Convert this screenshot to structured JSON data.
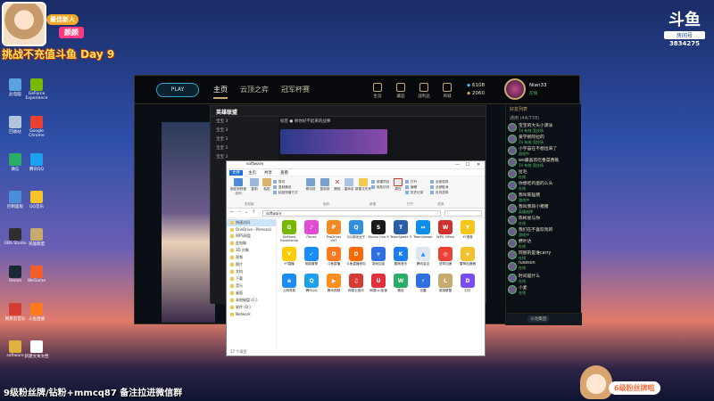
{
  "overlay": {
    "badge": "最佳新人",
    "name": "颜颜",
    "challenge": "挑战不充值斗鱼 Day 9",
    "bottom_text": "9级粉丝牌/钻粉+mmcq87 备注拉进微信群",
    "douyu_brand": "斗鱼",
    "room_label": "房间号",
    "room_number": "3834275",
    "fan_badge": "6级粉丝牌啦"
  },
  "desktop_icons": [
    {
      "label": "此电脑",
      "color": "#5ba3e0"
    },
    {
      "label": "GeForce Experience",
      "color": "#76b900"
    },
    {
      "label": "回收站",
      "color": "#b0c4de"
    },
    {
      "label": "Google Chrome",
      "color": "#e94235"
    },
    {
      "label": "微信",
      "color": "#2aae67"
    },
    {
      "label": "腾讯QQ",
      "color": "#1ea0f0"
    },
    {
      "label": "控制面板",
      "color": "#4a90d9"
    },
    {
      "label": "QQ音乐",
      "color": "#f7c52b"
    },
    {
      "label": "OBS Studio",
      "color": "#302e31"
    },
    {
      "label": "英雄联盟",
      "color": "#c8aa6e"
    },
    {
      "label": "Steam",
      "color": "#1b2838"
    },
    {
      "label": "WeGame",
      "color": "#f25f2c"
    },
    {
      "label": "网易云音乐",
      "color": "#d43c33"
    },
    {
      "label": "斗鱼直播",
      "color": "#ff7a1f"
    },
    {
      "label": "software",
      "color": "#e0b040"
    },
    {
      "label": "新建文本文档",
      "color": "#ffffff"
    }
  ],
  "lol": {
    "play": "PLAY",
    "tabs": [
      "主页",
      "云顶之弈",
      "冠军杯赛"
    ],
    "icons": [
      "生涯",
      "藏品",
      "战利品",
      "商城"
    ],
    "currency_be": "6108",
    "currency_rp": "2060",
    "username": "Nian33",
    "status": "在线",
    "friends_header": "好友列表",
    "friends_group": "通用 (44/778)",
    "friends": [
      {
        "name": "宝宝的大头小源泳",
        "status": "1V 有效·竞技场"
      },
      {
        "name": "爱学新阿拉的",
        "status": "1V 有效·竞技场"
      },
      {
        "name": "小宇宙在不想出来了",
        "status": "游戏中"
      },
      {
        "name": "wo最喜欢吃香菜香蕉",
        "status": "1V 有效·竞技场"
      },
      {
        "name": "拉毛",
        "status": "在线"
      },
      {
        "name": "你想吃鸡蛋的么头",
        "status": "在线"
      },
      {
        "name": "我叫陈猛猪",
        "status": "游戏中"
      },
      {
        "name": "我叫我哥小猪猪",
        "status": "英雄选择"
      },
      {
        "name": "陈彬星与你",
        "status": "在线"
      },
      {
        "name": "我们在不喜欢戏的",
        "status": "游戏中"
      },
      {
        "name": "野叶达",
        "status": "在线"
      },
      {
        "name": "阿丽的是谁carry",
        "status": "在线"
      },
      {
        "name": "fuseson",
        "status": "在线"
      },
      {
        "name": "时间是什么",
        "status": "在线"
      },
      {
        "name": "小麦",
        "status": "在线"
      }
    ],
    "friends_footer": "斗龙集团"
  },
  "assistant": {
    "logo": "英雄联盟",
    "banner": "标签 ● 帅你好不起来的战事",
    "rows": [
      "宝宝 3",
      "宝宝 3",
      "宝宝 3",
      "宝宝 3",
      "宝宝 3"
    ]
  },
  "explorer": {
    "title": "software",
    "menus": [
      "文件",
      "主页",
      "共享",
      "查看"
    ],
    "ribbon": {
      "pin": "固定到快速访问",
      "copy": "复制",
      "paste": "粘贴",
      "cut": "剪切",
      "copy_path": "复制路径",
      "paste_shortcut": "粘贴快捷方式",
      "move_to": "移动到",
      "copy_to": "复制到",
      "delete": "删除",
      "rename": "重命名",
      "new_folder": "新建文件夹",
      "new_item": "新建项目",
      "easy_access": "轻松访问",
      "properties": "属性",
      "open": "打开",
      "edit": "编辑",
      "history": "历史记录",
      "select_all": "全部选择",
      "select_none": "全部取消",
      "invert": "反向选择",
      "groups": [
        "剪贴板",
        "组织",
        "新建",
        "打开",
        "选择"
      ]
    },
    "path": "software",
    "nav": [
      "快速访问",
      "OneDrive - Personal",
      "WPS网盘",
      "此电脑",
      "3D 对象",
      "视频",
      "图片",
      "文档",
      "下载",
      "音乐",
      "桌面",
      "本地磁盘 (C:)",
      "软件 (D:)",
      "Network"
    ],
    "files": [
      {
        "label": "GeForce Experience",
        "color": "#76b900",
        "glyph": "G"
      },
      {
        "label": "iTunes",
        "color": "#e24cd3",
        "glyph": "♪"
      },
      {
        "label": "ProDriver V47",
        "color": "#f08a24",
        "glyph": "P"
      },
      {
        "label": "QQ游戏大厅",
        "color": "#2f8ee0",
        "glyph": "Q"
      },
      {
        "label": "Studio One 5",
        "color": "#1a1a1a",
        "glyph": "S"
      },
      {
        "label": "TeamSpeak 3",
        "color": "#2a5ea8",
        "glyph": "T"
      },
      {
        "label": "TeamViewer",
        "color": "#0e8ee9",
        "glyph": "↔"
      },
      {
        "label": "WPS Office",
        "color": "#d0312d",
        "glyph": "W"
      },
      {
        "label": "YY语音",
        "color": "#f5c518",
        "glyph": "Y"
      },
      {
        "label": "YY直播",
        "color": "#ffcc00",
        "glyph": "Y"
      },
      {
        "label": "电脑管家",
        "color": "#1a8cff",
        "glyph": "✓"
      },
      {
        "label": "斗鱼直播",
        "color": "#ff7a1f",
        "glyph": "D"
      },
      {
        "label": "斗鱼直播伴侣",
        "color": "#ff6a00",
        "glyph": "D"
      },
      {
        "label": "游戏加加",
        "color": "#2f6fe0",
        "glyph": "+"
      },
      {
        "label": "酷狗音乐",
        "color": "#1c7cf2",
        "glyph": "K"
      },
      {
        "label": "腾讯会议",
        "color": "#e0e6ee",
        "glyph": "▲"
      },
      {
        "label": "全球加速",
        "color": "#ea4335",
        "glyph": "◎"
      },
      {
        "label": "雷神加速器",
        "color": "#f2c12e",
        "glyph": "★"
      },
      {
        "label": "上网导航",
        "color": "#1c8cf2",
        "glyph": "e"
      },
      {
        "label": "腾讯QQ",
        "color": "#1ea0f0",
        "glyph": "Q"
      },
      {
        "label": "腾讯视频",
        "color": "#ff8f1f",
        "glyph": "▶"
      },
      {
        "label": "网易云音乐",
        "color": "#d43c33",
        "glyph": "♫"
      },
      {
        "label": "网易UU加速",
        "color": "#e0303c",
        "glyph": "U"
      },
      {
        "label": "微信",
        "color": "#2aae67",
        "glyph": "W"
      },
      {
        "label": "迅雷",
        "color": "#2f6fe0",
        "glyph": "⚡"
      },
      {
        "label": "英雄联盟",
        "color": "#c8aa6e",
        "glyph": "L"
      },
      {
        "label": "钉钉",
        "color": "#7a4df0",
        "glyph": "D"
      }
    ],
    "status": "27 个项目"
  }
}
